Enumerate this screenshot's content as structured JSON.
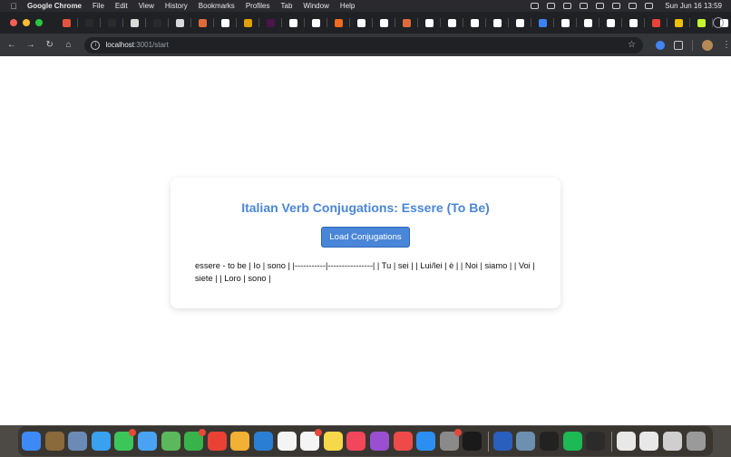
{
  "menubar": {
    "app_name": "Google Chrome",
    "items": [
      "File",
      "Edit",
      "View",
      "History",
      "Bookmarks",
      "Profiles",
      "Tab",
      "Window",
      "Help"
    ],
    "clock": "Sun Jun 16  13:59"
  },
  "browser": {
    "tab_colors": [
      "#e55340",
      "#2a2a2a",
      "#2a2a2a",
      "#d9d9d9",
      "#2a2a2a",
      "#d9d9d9",
      "#e06b3a",
      "#ffffff",
      "#e0a000",
      "#4a154b",
      "#ffffff",
      "#ffffff",
      "#f06b1f",
      "#ffffff",
      "#ffffff",
      "#e06b3a",
      "#ffffff",
      "#ffffff",
      "#ffffff",
      "#ffffff",
      "#ffffff",
      "#3b82f6",
      "#ffffff",
      "#ffffff",
      "#ffffff",
      "#ffffff",
      "#ea4335",
      "#f0c000",
      "#c6f432",
      "#ffffff"
    ],
    "active_tab_close": "✕",
    "new_tab": "+",
    "url_host": "localhost",
    "url_path": ":3001/start"
  },
  "page": {
    "title": "Italian Verb Conjugations: Essere (To Be)",
    "button_label": "Load Conjugations",
    "result_text": "essere - to be | Io | sono | |-----------|----------------| | Tu | sei | | Lui/lei | è | | Noi | siamo | | Voi | siete | | Loro | sono |"
  },
  "colors": {
    "accent": "#4a86d8",
    "menubar_bg": "#2a2a2e",
    "tabstrip_bg": "#202124",
    "toolbar_bg": "#35363a"
  },
  "dock": {
    "apps": [
      {
        "name": "finder-icon",
        "color": "#3d8af7"
      },
      {
        "name": "launchpad-icon",
        "color": "#8a6a3a"
      },
      {
        "name": "mission-control-icon",
        "color": "#6b8bb6"
      },
      {
        "name": "safari-icon",
        "color": "#3aa0f0"
      },
      {
        "name": "messages-icon",
        "color": "#3bc65a",
        "badge": true
      },
      {
        "name": "mail-icon",
        "color": "#4aa3f2"
      },
      {
        "name": "maps-icon",
        "color": "#5cb85c"
      },
      {
        "name": "facetime-icon",
        "color": "#38b24a",
        "badge": true
      },
      {
        "name": "chrome-icon",
        "color": "#e94235"
      },
      {
        "name": "photos-icon",
        "color": "#f2b134"
      },
      {
        "name": "vscode-icon",
        "color": "#2a7fd4"
      },
      {
        "name": "calendar-icon",
        "color": "#f4f4f4"
      },
      {
        "name": "reminders-icon",
        "color": "#f4f4f4",
        "badge": true
      },
      {
        "name": "notes-icon",
        "color": "#f7d84a"
      },
      {
        "name": "music-icon",
        "color": "#f2465b"
      },
      {
        "name": "podcasts-icon",
        "color": "#9a4fd0"
      },
      {
        "name": "news-icon",
        "color": "#ef4a4a"
      },
      {
        "name": "app-store-icon",
        "color": "#2c8ef0"
      },
      {
        "name": "system-settings-icon",
        "color": "#8a8a8a",
        "badge": true
      },
      {
        "name": "tv-icon",
        "color": "#1a1a1a"
      },
      {
        "name": "word-icon",
        "color": "#2b5fbd"
      },
      {
        "name": "preview-icon",
        "color": "#6d8fb0"
      },
      {
        "name": "cursor-icon",
        "color": "#222222"
      },
      {
        "name": "spotify-icon",
        "color": "#1db954"
      },
      {
        "name": "terminal-icon",
        "color": "#2b2b2b"
      },
      {
        "name": "document-icon",
        "color": "#e8e8e8"
      },
      {
        "name": "document-c-icon",
        "color": "#e8e8e8"
      },
      {
        "name": "screen-icon",
        "color": "#cfcfcf"
      },
      {
        "name": "trash-icon",
        "color": "#9a9a9a"
      }
    ]
  }
}
